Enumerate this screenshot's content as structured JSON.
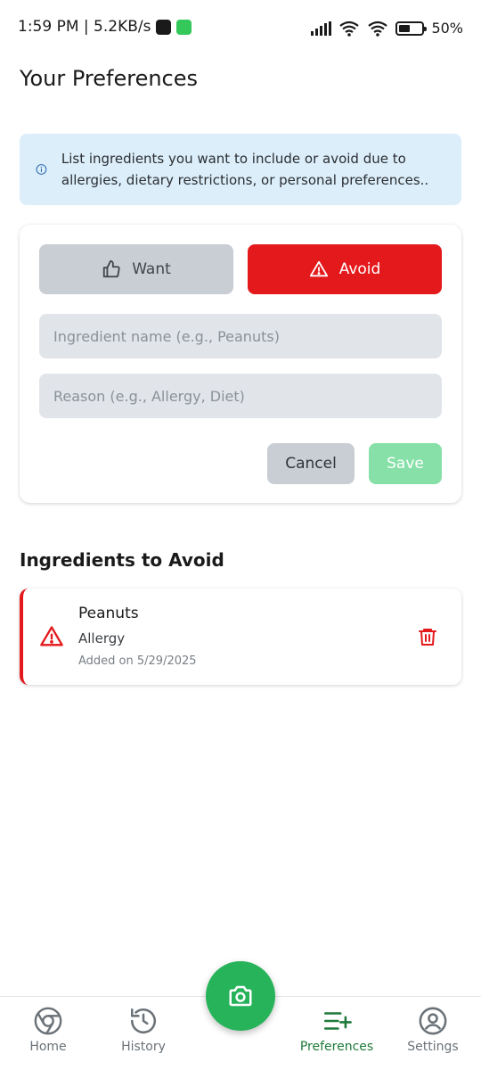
{
  "status_bar": {
    "time": "1:59 PM | 5.2KB/s",
    "battery": "50%",
    "battery_level": 0.5
  },
  "page": {
    "title": "Your Preferences"
  },
  "info": {
    "icon": "info-icon",
    "text": "List ingredients you want to include or avoid due to allergies, dietary restrictions, or personal preferences.."
  },
  "form": {
    "want_label": "Want",
    "avoid_label": "Avoid",
    "selected_type": "Avoid",
    "name_value": "",
    "name_placeholder": "Ingredient name (e.g., Peanuts)",
    "reason_value": "",
    "reason_placeholder": "Reason (e.g., Allergy, Diet)",
    "cancel_label": "Cancel",
    "save_label": "Save"
  },
  "avoid_section": {
    "title": "Ingredients to Avoid",
    "items": [
      {
        "name": "Peanuts",
        "reason": "Allergy",
        "added": "Added on 5/29/2025"
      }
    ]
  },
  "nav": {
    "home": "Home",
    "history": "History",
    "preferences": "Preferences",
    "settings": "Settings",
    "active": "Preferences"
  },
  "colors": {
    "avoid_red": "#e4191c",
    "accent_green": "#27b35a",
    "info_bg": "#dceefa"
  }
}
